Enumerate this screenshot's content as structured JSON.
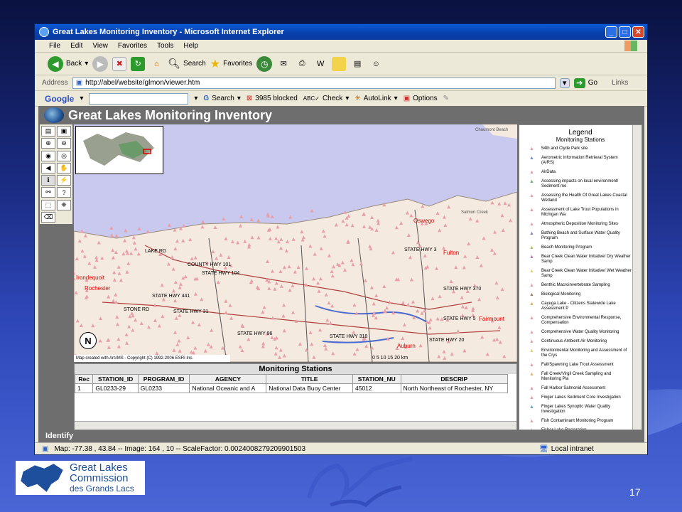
{
  "browser": {
    "title": "Great Lakes Monitoring Inventory - Microsoft Internet Explorer",
    "menu": [
      "File",
      "Edit",
      "View",
      "Favorites",
      "Tools",
      "Help"
    ],
    "toolbar": {
      "back": "Back",
      "search": "Search",
      "favorites": "Favorites"
    },
    "address_label": "Address",
    "address": "http://abel/website/glmon/viewer.htm",
    "go": "Go",
    "links": "Links",
    "google": {
      "brand": "Google",
      "search": "Search",
      "blocked": "3985 blocked",
      "check": "Check",
      "autolink": "AutoLink",
      "options": "Options"
    }
  },
  "app": {
    "title": "Great Lakes Monitoring Inventory",
    "identify": "Identify",
    "map_credit": "Map created with ArcIMS - Copyright (C) 1992-2006 ESRI Inc.",
    "scale": "0   5   10   15   20 km",
    "north": "N",
    "place_labels": [
      "Oswego",
      "Fulton",
      "Rochester",
      "Irondequoit",
      "Auburn",
      "Fairmount",
      "Chaumont Beach",
      "Salmon Creek"
    ],
    "road_labels": [
      "STATE HWY 3",
      "STATE HWY 104",
      "COUNTY HWY 101",
      "STATE HWY 370",
      "STATE HWY 31",
      "STATE HWY 5",
      "STATE HWY 20",
      "STATE HWY 96",
      "STATE HWY 441",
      "STATE HWY 318",
      "STONE RD",
      "LAKE RD"
    ],
    "legend": {
      "title": "Legend",
      "subtitle": "Monitoring Stations",
      "items": [
        "54th and Clyde Park site",
        "Aerometric Information Retrieval System (AIRS)",
        "AirData",
        "Assessing impacts on local environment/ Sediment mo",
        "Assessing the Health Of Great Lakes Coastal Wetland",
        "Assessment of Lake Trout Populations in Michigan Wa",
        "Atmospheric Deposition Monitoring Sites",
        "Bathing Beach and Surface Water Quality Program",
        "Beach Monitoring Program",
        "Bear Creek Clean Water Initiative/ Dry Weather Samp",
        "Bear Creek Clean Water Initiative/ Wet Weather Samp",
        "Benthic Macroinvertebrate Sampling",
        "Biological Monitoring",
        "Cayuga Lake - Citizens Statewide Lake Assessment P",
        "Comprehensive Environmental Response, Compensation",
        "Comprehensive Water Quality Monitoring",
        "Continuous Ambient Air Monitoring",
        "Environmental Monitoring and Assessment of the Crys",
        "Fall/Spawning Lake Trout Assessment",
        "Fall Creek/Virgil Creek Sampling and Monitoring Pla",
        "Fall Harbor Salmonid Assessment",
        "Finger Lakes Sediment Core Investigation",
        "Finger Lakes Synoptic Water Quality Investigation",
        "Fish Contaminant Monitoring Program",
        "Fisher Lake Restoration",
        "Great Lakes Fish Monitoring Program"
      ],
      "colors": [
        "#e89aa0",
        "#6a8fd0",
        "#e89aa0",
        "#6ab06a",
        "#e89aa0",
        "#e89aa0",
        "#e89aa0",
        "#8a7ad0",
        "#a8c060",
        "#c070c0",
        "#e0d060",
        "#e89aa0",
        "#a08060",
        "#e0b060",
        "#e89aa0",
        "#e89aa0",
        "#e89aa0",
        "#e0d060",
        "#e89aa0",
        "#e0b060",
        "#e89aa0",
        "#e89aa0",
        "#60a0c0",
        "#e89aa0",
        "#e89aa0",
        "#e89aa0"
      ]
    },
    "table": {
      "title": "Monitoring Stations",
      "columns": [
        "Rec",
        "STATION_ID",
        "PROGRAM_ID",
        "AGENCY",
        "TITLE",
        "STATION_NU",
        "DESCRIP"
      ],
      "rows": [
        [
          "1",
          "GL0233-29",
          "GL0233",
          "National Oceanic and A",
          "National Data Buoy Center",
          "45012",
          "North Northeast of Rochester, NY"
        ]
      ]
    }
  },
  "status": {
    "text": "Map: -77.38 , 43.84 -- Image: 164 , 10 -- ScaleFactor: 0.0024008279209901503",
    "zone": "Local intranet"
  },
  "slide": {
    "logo_line1": "Great Lakes",
    "logo_line2": "Commission",
    "logo_line3": "des Grands Lacs",
    "page": "17"
  }
}
